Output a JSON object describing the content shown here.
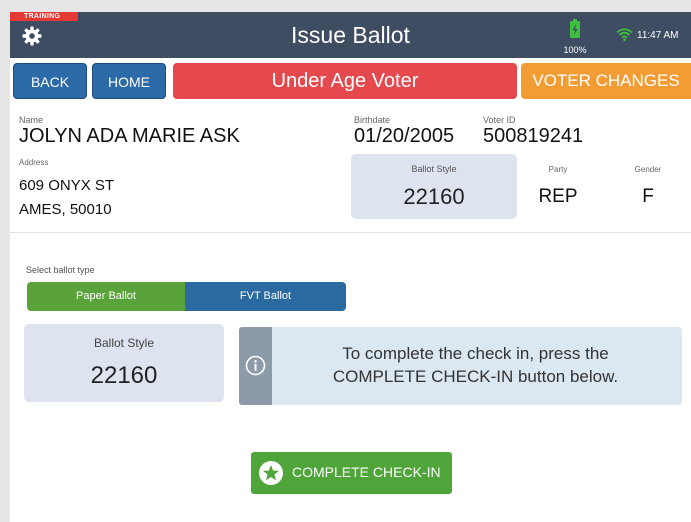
{
  "header": {
    "training_badge": "TRAINING",
    "title": "Issue Ballot",
    "battery_percent": "100%",
    "time": "11:47 AM",
    "icons": [
      "gear-icon",
      "battery-icon",
      "wifi-icon"
    ]
  },
  "nav": {
    "back_label": "BACK",
    "home_label": "HOME",
    "alert_banner": "Under Age Voter",
    "voter_changes_label": "VOTER CHANGES"
  },
  "voter": {
    "name_label": "Name",
    "name": "JOLYN ADA MARIE ASK",
    "birthdate_label": "Birthdate",
    "birthdate": "01/20/2005",
    "voter_id_label": "Voter ID",
    "voter_id": "500819241",
    "address_label": "Address",
    "address_line1": "609 ONYX ST",
    "address_line2": "AMES, 50010",
    "ballot_style_label": "Ballot Style",
    "ballot_style": "22160",
    "party_label": "Party",
    "party": "REP",
    "gender_label": "Gender",
    "gender": "F"
  },
  "ballot_type": {
    "prompt": "Select ballot type",
    "options": [
      "Paper Ballot",
      "FVT Ballot"
    ],
    "selected": "Paper Ballot"
  },
  "ballot_card": {
    "label": "Ballot Style",
    "value": "22160"
  },
  "info": {
    "line1": "To complete the check in, press the",
    "line2": "COMPLETE CHECK-IN button below."
  },
  "complete_button": {
    "label": "COMPLETE CHECK-IN"
  },
  "colors": {
    "topbar": "#3f4d62",
    "nav_blue": "#2c6aa8",
    "alert_red": "#e5484d",
    "changes_orange": "#f39c34",
    "selected_green": "#5aa33a",
    "fvt_blue": "#2b6aa0",
    "complete_green": "#4fa43a"
  }
}
